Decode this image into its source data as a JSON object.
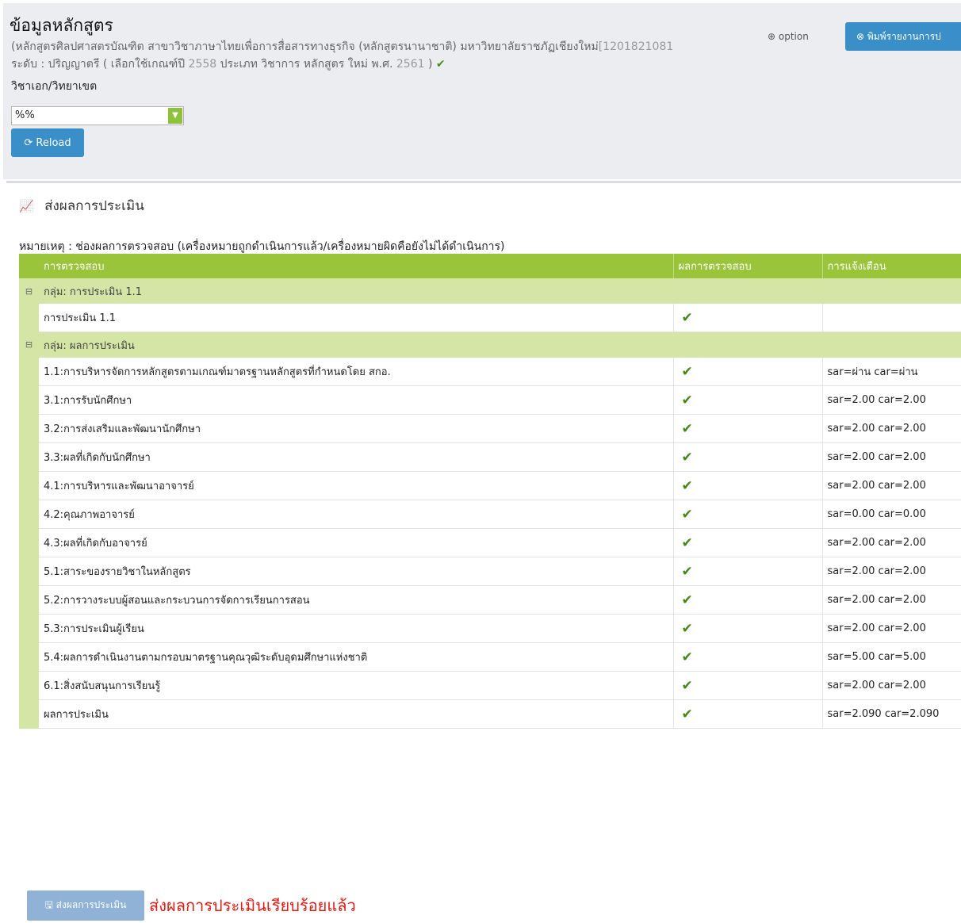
{
  "header": {
    "title": "ข้อมูลหลักสูตร",
    "program_line_a": "(หลักสูตรศิลปศาสตรบัณฑิต สาขาวิชาภาษาไทยเพื่อการสื่อสารทางธุรกิจ (หลักสูตรนานาชาติ) มหาวิทยาลัยราชภัฏเชียงใหม่",
    "program_code": "[1201821081",
    "level_prefix": "ระดับ : ปริญญาตรี ( เลือกใช้เกณฑ์ปี",
    "criteria_year": "2558",
    "type_label": "ประเภท วิชาการ หลักสูตร ใหม่ พ.ศ.",
    "program_year": "2561",
    "level_suffix": ")",
    "check_glyph": "✔",
    "option_label": "option",
    "print_button": "พิมพ์รายงานการป"
  },
  "filter": {
    "major_label": "วิชาเอก/วิทยาเขต",
    "major_value": "%%",
    "reload_button": "Reload"
  },
  "section": {
    "title": "ส่งผลการประเมิน",
    "note": "หมายเหตุ : ช่องผลการตรวจสอบ (เครื่องหมายถูกดำเนินการแล้ว/เครื่องหมายผิดคือยังไม่ได้ดำเนินการ)"
  },
  "table": {
    "columns": [
      "การตรวจสอบ",
      "ผลการตรวจสอบ",
      "การแจ้งเตือน"
    ],
    "group_1": "กลุ่ม: การประเมิน 1.1",
    "group_2": "กลุ่ม: ผลการประเมิน",
    "rows": [
      {
        "item": "การประเมิน 1.1",
        "result": "✔",
        "alert": ""
      },
      {
        "item": "1.1:การบริหารจัดการหลักสูตรตามเกณฑ์มาตรฐานหลักสูตรที่กำหนดโดย สกอ.",
        "result": "✔",
        "alert": "sar=ผ่าน car=ผ่าน"
      },
      {
        "item": "3.1:การรับนักศึกษา",
        "result": "✔",
        "alert": "sar=2.00 car=2.00"
      },
      {
        "item": "3.2:การส่งเสริมและพัฒนานักศึกษา",
        "result": "✔",
        "alert": "sar=2.00 car=2.00"
      },
      {
        "item": "3.3:ผลที่เกิดกับนักศึกษา",
        "result": "✔",
        "alert": "sar=2.00 car=2.00"
      },
      {
        "item": "4.1:การบริหารและพัฒนาอาจารย์",
        "result": "✔",
        "alert": "sar=2.00 car=2.00"
      },
      {
        "item": "4.2:คุณภาพอาจารย์",
        "result": "✔",
        "alert": "sar=0.00 car=0.00"
      },
      {
        "item": "4.3:ผลที่เกิดกับอาจารย์",
        "result": "✔",
        "alert": "sar=2.00 car=2.00"
      },
      {
        "item": "5.1:สาระของรายวิชาในหลักสูตร",
        "result": "✔",
        "alert": "sar=2.00 car=2.00"
      },
      {
        "item": "5.2:การวางระบบผู้สอนและกระบวนการจัดการเรียนการสอน",
        "result": "✔",
        "alert": "sar=2.00 car=2.00"
      },
      {
        "item": "5.3:การประเมินผู้เรียน",
        "result": "✔",
        "alert": "sar=2.00 car=2.00"
      },
      {
        "item": "5.4:ผลการดำเนินงานตามกรอบมาตรฐานคุณวุฒิระดับอุดมศึกษาแห่งชาติ",
        "result": "✔",
        "alert": "sar=5.00 car=5.00"
      },
      {
        "item": "6.1:สิ่งสนับสนุนการเรียนรู้",
        "result": "✔",
        "alert": "sar=2.00 car=2.00"
      },
      {
        "item": "ผลการประเมิน",
        "result": "✔",
        "alert": "sar=2.090 car=2.090"
      }
    ]
  },
  "footer": {
    "submit_button": "ส่งผลการประเมิน",
    "status_text": "ส่งผลการประเมินเรียบร้อยแล้ว"
  },
  "colors": {
    "header_green": "#9ac43a",
    "group_green": "#d5e5a5",
    "primary_blue": "#3a8fc8",
    "check_green": "#3e8a17",
    "alert_red": "#e8180f"
  },
  "icons": {
    "option": "dashboard-icon",
    "print": "close-circle-icon",
    "reload": "refresh-icon",
    "section": "line-chart-icon",
    "group_toggle": "collapse-icon",
    "submit": "save-icon"
  }
}
